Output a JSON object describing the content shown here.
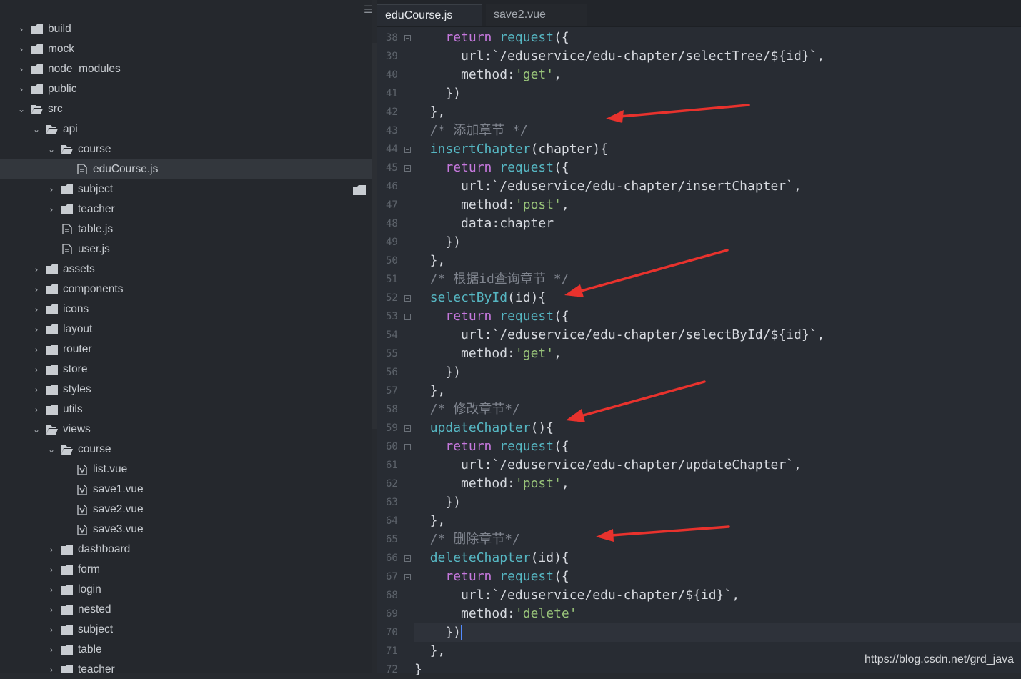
{
  "sidebar": {
    "menu_icon": "hamburger-icon",
    "items": [
      {
        "label": "build",
        "type": "folder",
        "depth": 0,
        "expanded": false
      },
      {
        "label": "mock",
        "type": "folder",
        "depth": 0,
        "expanded": false
      },
      {
        "label": "node_modules",
        "type": "folder",
        "depth": 0,
        "expanded": false
      },
      {
        "label": "public",
        "type": "folder",
        "depth": 0,
        "expanded": false
      },
      {
        "label": "src",
        "type": "folder",
        "depth": 0,
        "expanded": true
      },
      {
        "label": "api",
        "type": "folder",
        "depth": 1,
        "expanded": true
      },
      {
        "label": "course",
        "type": "folder",
        "depth": 2,
        "expanded": true
      },
      {
        "label": "eduCourse.js",
        "type": "file",
        "depth": 3,
        "selected": true
      },
      {
        "label": "subject",
        "type": "folder",
        "depth": 2,
        "expanded": false
      },
      {
        "label": "teacher",
        "type": "folder",
        "depth": 2,
        "expanded": false
      },
      {
        "label": "table.js",
        "type": "file",
        "depth": 2
      },
      {
        "label": "user.js",
        "type": "file",
        "depth": 2
      },
      {
        "label": "assets",
        "type": "folder",
        "depth": 1,
        "expanded": false
      },
      {
        "label": "components",
        "type": "folder",
        "depth": 1,
        "expanded": false
      },
      {
        "label": "icons",
        "type": "folder",
        "depth": 1,
        "expanded": false
      },
      {
        "label": "layout",
        "type": "folder",
        "depth": 1,
        "expanded": false
      },
      {
        "label": "router",
        "type": "folder",
        "depth": 1,
        "expanded": false
      },
      {
        "label": "store",
        "type": "folder",
        "depth": 1,
        "expanded": false
      },
      {
        "label": "styles",
        "type": "folder",
        "depth": 1,
        "expanded": false
      },
      {
        "label": "utils",
        "type": "folder",
        "depth": 1,
        "expanded": false
      },
      {
        "label": "views",
        "type": "folder",
        "depth": 1,
        "expanded": true
      },
      {
        "label": "course",
        "type": "folder",
        "depth": 2,
        "expanded": true
      },
      {
        "label": "list.vue",
        "type": "vue",
        "depth": 3
      },
      {
        "label": "save1.vue",
        "type": "vue",
        "depth": 3
      },
      {
        "label": "save2.vue",
        "type": "vue",
        "depth": 3
      },
      {
        "label": "save3.vue",
        "type": "vue",
        "depth": 3
      },
      {
        "label": "dashboard",
        "type": "folder",
        "depth": 2,
        "expanded": false
      },
      {
        "label": "form",
        "type": "folder",
        "depth": 2,
        "expanded": false
      },
      {
        "label": "login",
        "type": "folder",
        "depth": 2,
        "expanded": false
      },
      {
        "label": "nested",
        "type": "folder",
        "depth": 2,
        "expanded": false
      },
      {
        "label": "subject",
        "type": "folder",
        "depth": 2,
        "expanded": false
      },
      {
        "label": "table",
        "type": "folder",
        "depth": 2,
        "expanded": false
      },
      {
        "label": "teacher",
        "type": "folder",
        "depth": 2,
        "expanded": false
      }
    ]
  },
  "tabs": [
    {
      "label": "eduCourse.js",
      "active": true
    },
    {
      "label": "save2.vue",
      "active": false
    }
  ],
  "editor": {
    "lines": [
      {
        "n": "38",
        "fold": true,
        "segs": [
          [
            "",
            "    "
          ],
          [
            "kw",
            "return"
          ],
          [
            "",
            " "
          ],
          [
            "fn",
            "request"
          ],
          [
            "",
            "({"
          ]
        ]
      },
      {
        "n": "39",
        "fold": false,
        "segs": [
          [
            "",
            "      url:`/eduservice/edu-chapter/selectTree/${id}`,"
          ]
        ]
      },
      {
        "n": "40",
        "fold": false,
        "segs": [
          [
            "",
            "      method:"
          ],
          [
            "str",
            "'get'"
          ],
          [
            "",
            ","
          ]
        ]
      },
      {
        "n": "41",
        "fold": false,
        "segs": [
          [
            "",
            "    })"
          ]
        ]
      },
      {
        "n": "42",
        "fold": false,
        "segs": [
          [
            "",
            "  },"
          ]
        ]
      },
      {
        "n": "43",
        "fold": false,
        "segs": [
          [
            "",
            "  "
          ],
          [
            "cm",
            "/* 添加章节 */"
          ]
        ]
      },
      {
        "n": "44",
        "fold": true,
        "segs": [
          [
            "",
            "  "
          ],
          [
            "fn",
            "insertChapter"
          ],
          [
            "",
            "(chapter){"
          ]
        ]
      },
      {
        "n": "45",
        "fold": true,
        "segs": [
          [
            "",
            "    "
          ],
          [
            "kw",
            "return"
          ],
          [
            "",
            " "
          ],
          [
            "fn",
            "request"
          ],
          [
            "",
            "({"
          ]
        ]
      },
      {
        "n": "46",
        "fold": false,
        "segs": [
          [
            "",
            "      url:`/eduservice/edu-chapter/insertChapter`,"
          ]
        ]
      },
      {
        "n": "47",
        "fold": false,
        "segs": [
          [
            "",
            "      method:"
          ],
          [
            "str",
            "'post'"
          ],
          [
            "",
            ","
          ]
        ]
      },
      {
        "n": "48",
        "fold": false,
        "segs": [
          [
            "",
            "      data:chapter"
          ]
        ]
      },
      {
        "n": "49",
        "fold": false,
        "segs": [
          [
            "",
            "    })"
          ]
        ]
      },
      {
        "n": "50",
        "fold": false,
        "segs": [
          [
            "",
            "  },"
          ]
        ]
      },
      {
        "n": "51",
        "fold": false,
        "segs": [
          [
            "",
            "  "
          ],
          [
            "cm",
            "/* 根据id查询章节 */"
          ]
        ]
      },
      {
        "n": "52",
        "fold": true,
        "segs": [
          [
            "",
            "  "
          ],
          [
            "fn",
            "selectById"
          ],
          [
            "",
            "(id){"
          ]
        ]
      },
      {
        "n": "53",
        "fold": true,
        "segs": [
          [
            "",
            "    "
          ],
          [
            "kw",
            "return"
          ],
          [
            "",
            " "
          ],
          [
            "fn",
            "request"
          ],
          [
            "",
            "({"
          ]
        ]
      },
      {
        "n": "54",
        "fold": false,
        "segs": [
          [
            "",
            "      url:`/eduservice/edu-chapter/selectById/${id}`,"
          ]
        ]
      },
      {
        "n": "55",
        "fold": false,
        "segs": [
          [
            "",
            "      method:"
          ],
          [
            "str",
            "'get'"
          ],
          [
            "",
            ","
          ]
        ]
      },
      {
        "n": "56",
        "fold": false,
        "segs": [
          [
            "",
            "    })"
          ]
        ]
      },
      {
        "n": "57",
        "fold": false,
        "segs": [
          [
            "",
            "  },"
          ]
        ]
      },
      {
        "n": "58",
        "fold": false,
        "segs": [
          [
            "",
            "  "
          ],
          [
            "cm",
            "/* 修改章节*/"
          ]
        ]
      },
      {
        "n": "59",
        "fold": true,
        "segs": [
          [
            "",
            "  "
          ],
          [
            "fn",
            "updateChapter"
          ],
          [
            "",
            "(){"
          ]
        ]
      },
      {
        "n": "60",
        "fold": true,
        "segs": [
          [
            "",
            "    "
          ],
          [
            "kw",
            "return"
          ],
          [
            "",
            " "
          ],
          [
            "fn",
            "request"
          ],
          [
            "",
            "({"
          ]
        ]
      },
      {
        "n": "61",
        "fold": false,
        "segs": [
          [
            "",
            "      url:`/eduservice/edu-chapter/updateChapter`,"
          ]
        ]
      },
      {
        "n": "62",
        "fold": false,
        "segs": [
          [
            "",
            "      method:"
          ],
          [
            "str",
            "'post'"
          ],
          [
            "",
            ","
          ]
        ]
      },
      {
        "n": "63",
        "fold": false,
        "segs": [
          [
            "",
            "    })"
          ]
        ]
      },
      {
        "n": "64",
        "fold": false,
        "segs": [
          [
            "",
            "  },"
          ]
        ]
      },
      {
        "n": "65",
        "fold": false,
        "segs": [
          [
            "",
            "  "
          ],
          [
            "cm",
            "/* 删除章节*/"
          ]
        ]
      },
      {
        "n": "66",
        "fold": true,
        "segs": [
          [
            "",
            "  "
          ],
          [
            "fn",
            "deleteChapter"
          ],
          [
            "",
            "(id){"
          ]
        ]
      },
      {
        "n": "67",
        "fold": true,
        "segs": [
          [
            "",
            "    "
          ],
          [
            "kw",
            "return"
          ],
          [
            "",
            " "
          ],
          [
            "fn",
            "request"
          ],
          [
            "",
            "({"
          ]
        ]
      },
      {
        "n": "68",
        "fold": false,
        "segs": [
          [
            "",
            "      url:`/eduservice/edu-chapter/${id}`,"
          ]
        ]
      },
      {
        "n": "69",
        "fold": false,
        "segs": [
          [
            "",
            "      method:"
          ],
          [
            "str",
            "'delete'"
          ]
        ]
      },
      {
        "n": "70",
        "fold": false,
        "active": true,
        "segs": [
          [
            "",
            "    })"
          ],
          [
            "caret",
            ""
          ]
        ]
      },
      {
        "n": "71",
        "fold": false,
        "segs": [
          [
            "",
            "  },"
          ]
        ]
      },
      {
        "n": "72",
        "fold": false,
        "segs": [
          [
            "",
            "}"
          ]
        ]
      }
    ]
  },
  "colors": {
    "keyword": "#c678dd",
    "function": "#56b6c2",
    "string": "#98c379",
    "comment": "#7f848e",
    "arrow": "#e8322d"
  },
  "watermark": "https://blog.csdn.net/grd_java"
}
